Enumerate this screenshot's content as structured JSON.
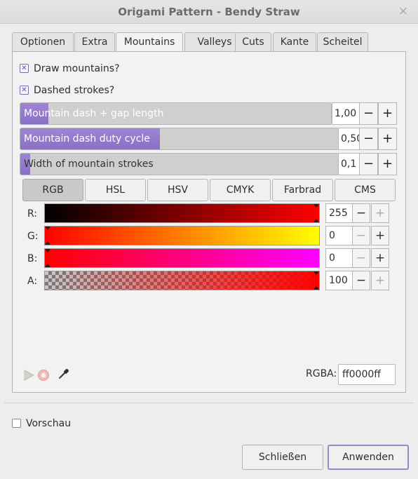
{
  "window": {
    "title": "Origami Pattern - Bendy Straw",
    "close_glyph": "×"
  },
  "tabs": [
    {
      "label": "Optionen"
    },
    {
      "label": "Extra"
    },
    {
      "label": "Mountains",
      "active": true
    },
    {
      "label": "Valleys"
    },
    {
      "label": "Cuts"
    },
    {
      "label": "Kante"
    },
    {
      "label": "Scheitel"
    }
  ],
  "mountains": {
    "draw_mountains": {
      "label": "Draw mountains?",
      "checked": true
    },
    "dashed_strokes": {
      "label": "Dashed strokes?",
      "checked": true
    },
    "check_glyph": "✕",
    "dash_gap": {
      "label": "Mountain dash + gap length",
      "value": "1,00",
      "fill_fraction": 0.09
    },
    "duty_cycle": {
      "label": "Mountain dash duty cycle",
      "value": "0,50",
      "fill_fraction": 0.44
    },
    "stroke_width": {
      "label": "Width of mountain strokes",
      "value": "0,1",
      "fill_fraction": 0.03
    },
    "minus_glyph": "−",
    "plus_glyph": "+"
  },
  "color_modes": [
    {
      "label": "RGB",
      "active": true
    },
    {
      "label": "HSL"
    },
    {
      "label": "HSV"
    },
    {
      "label": "CMYK"
    },
    {
      "label": "Farbrad"
    },
    {
      "label": "CMS"
    }
  ],
  "channels": [
    {
      "label": "R:",
      "value": "255",
      "minus_enabled": true,
      "plus_enabled": false,
      "fraction": 1.0
    },
    {
      "label": "G:",
      "value": "0",
      "minus_enabled": false,
      "plus_enabled": true,
      "fraction": 0.0
    },
    {
      "label": "B:",
      "value": "0",
      "minus_enabled": false,
      "plus_enabled": true,
      "fraction": 0.0
    },
    {
      "label": "A:",
      "value": "100",
      "minus_enabled": true,
      "plus_enabled": false,
      "fraction": 1.0
    }
  ],
  "icons": [
    "color-managed-icon",
    "out-of-gamut-icon",
    "eyedropper-icon"
  ],
  "rgba": {
    "label": "RGBA:",
    "value": "ff0000ff"
  },
  "preview": {
    "label": "Vorschau",
    "checked": false
  },
  "buttons": {
    "close_label": "Schließen",
    "apply_label": "Anwenden"
  },
  "colors": {
    "accent": "#8a6fc4",
    "selected_color": "#ff0000"
  }
}
